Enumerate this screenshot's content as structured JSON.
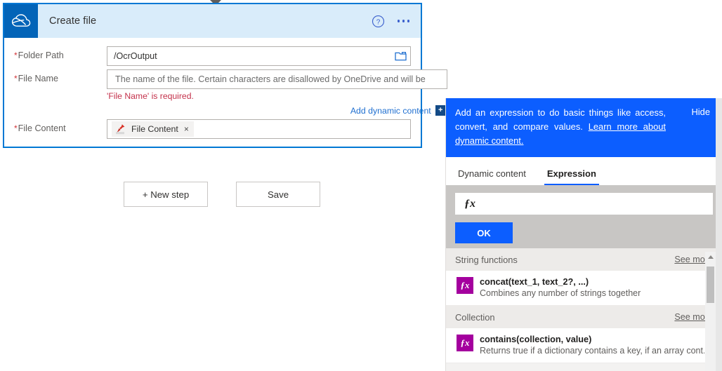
{
  "card": {
    "icon": "onedrive-cloud-icon",
    "title": "Create file",
    "help_icon": "help-circle-icon",
    "more_icon": "ellipsis-icon",
    "fields": [
      {
        "label": "Folder Path",
        "required_marker": "*",
        "value": "/OcrOutput",
        "trailing_icon": "folder-picker-icon"
      },
      {
        "label": "File Name",
        "required_marker": "*",
        "placeholder": "The name of the file. Certain characters are disallowed by OneDrive and will be",
        "error": "'File Name' is required."
      },
      {
        "label": "File Content",
        "required_marker": "*",
        "token": {
          "icon": "api-key-pin-icon",
          "label": "File Content",
          "remove": "×"
        }
      }
    ],
    "dynamic_content_link": "Add dynamic content",
    "dynamic_content_plus": "+"
  },
  "step_buttons": [
    {
      "label": "+ New step"
    },
    {
      "label": "Save"
    }
  ],
  "panel": {
    "banner": {
      "text_before_link": "Add an expression to do basic things like access, convert, and compare values. ",
      "link_text": "Learn more about dynamic content.",
      "hide_label": "Hide"
    },
    "tabs": [
      {
        "label": "Dynamic content",
        "active": false
      },
      {
        "label": "Expression",
        "active": true
      }
    ],
    "expression_input": {
      "fx_glyph": "ƒx",
      "value": "",
      "placeholder": ""
    },
    "ok_label": "OK",
    "see_more_label": "See more",
    "groups": [
      {
        "title": "String functions",
        "see_more": "See more",
        "items": [
          {
            "badge": "ƒx",
            "signature": "concat(text_1, text_2?, ...)",
            "description": "Combines any number of strings together"
          }
        ]
      },
      {
        "title": "Collection",
        "see_more": "See more",
        "items": [
          {
            "badge": "ƒx",
            "signature": "contains(collection, value)",
            "description": "Returns true if a dictionary contains a key, if an array cont..."
          }
        ]
      }
    ],
    "scrollbar": {
      "up_arrow": "scroll-up-arrow-icon"
    }
  },
  "colors": {
    "accent_blue": "#0078d4",
    "banner_blue": "#0c5eff",
    "onedrive_blue": "#0364b8",
    "error_red": "#c4314b",
    "fx_magenta": "#a4009e",
    "card_header_bg": "#d9ecfa"
  }
}
